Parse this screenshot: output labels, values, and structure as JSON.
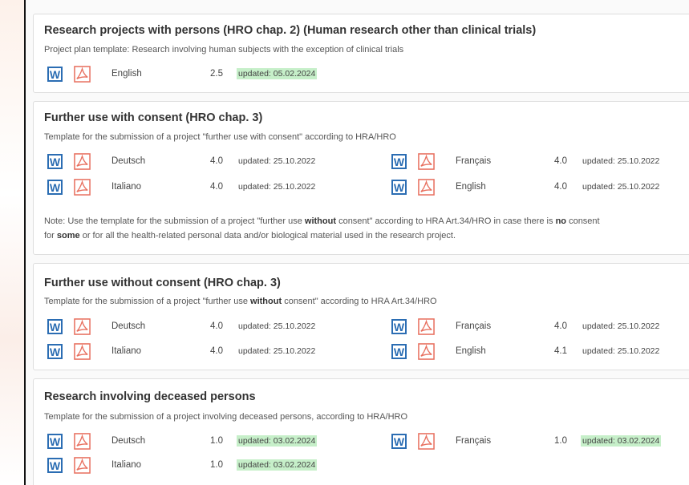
{
  "colors": {
    "word_blue": "#2b6db3",
    "pdf_red": "#e8705f",
    "updated_highlight": "#c6efc9"
  },
  "sections": [
    {
      "title": "Research projects with persons (HRO chap. 2) (Human research other than clinical trials)",
      "description": "Project plan template: Research involving human subjects with the exception of clinical trials",
      "docs": [
        {
          "language": "English",
          "version": "2.5",
          "updated": "updated: 05.02.2024",
          "highlight": true
        }
      ]
    },
    {
      "title": "Further use with consent (HRO chap. 3)",
      "description": "Template for the submission of a project \"further use with consent\" according to HRA/HRO",
      "docs": [
        {
          "language": "Deutsch",
          "version": "4.0",
          "updated": "updated: 25.10.2022",
          "highlight": false
        },
        {
          "language": "Français",
          "version": "4.0",
          "updated": "updated: 25.10.2022",
          "highlight": false
        },
        {
          "language": "Italiano",
          "version": "4.0",
          "updated": "updated: 25.10.2022",
          "highlight": false
        },
        {
          "language": "English",
          "version": "4.0",
          "updated": "updated: 25.10.2022",
          "highlight": false
        }
      ],
      "note": {
        "p1": "Note: Use the template for the submission of a project \"further use ",
        "b1": "without",
        "p2": " consent\" according to HRA Art.34/HRO in case there is ",
        "b2": "no",
        "p3": " consent",
        "p4": "for ",
        "b3": "some",
        "p5": " or for all the health-related personal data and/or biological material used in the research project."
      }
    },
    {
      "title": "Further use without consent (HRO chap. 3)",
      "description_pre": "Template for the submission of a project \"further use ",
      "description_bold": "without",
      "description_post": " consent\" according to HRA Art.34/HRO",
      "docs": [
        {
          "language": "Deutsch",
          "version": "4.0",
          "updated": "updated: 25.10.2022",
          "highlight": false
        },
        {
          "language": "Français",
          "version": "4.0",
          "updated": "updated: 25.10.2022",
          "highlight": false
        },
        {
          "language": "Italiano",
          "version": "4.0",
          "updated": "updated: 25.10.2022",
          "highlight": false
        },
        {
          "language": "English",
          "version": "4.1",
          "updated": "updated: 25.10.2022",
          "highlight": false
        }
      ]
    },
    {
      "title": "Research involving deceased persons",
      "description": "Template for the submission of a project involving deceased persons, according to HRA/HRO",
      "docs": [
        {
          "language": "Deutsch",
          "version": "1.0",
          "updated": "updated: 03.02.2024",
          "highlight": true
        },
        {
          "language": "Français",
          "version": "1.0",
          "updated": "updated: 03.02.2024",
          "highlight": true
        },
        {
          "language": "Italiano",
          "version": "1.0",
          "updated": "updated: 03.02.2024",
          "highlight": true
        }
      ]
    }
  ]
}
